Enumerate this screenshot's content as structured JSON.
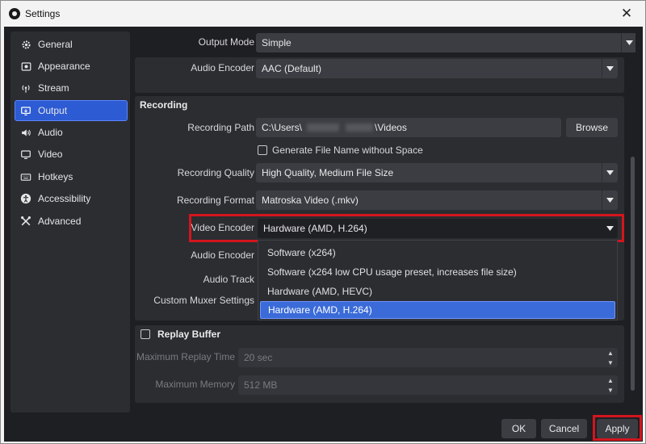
{
  "window": {
    "title": "Settings",
    "close_glyph": "✕"
  },
  "sidebar": {
    "items": [
      {
        "label": "General",
        "icon": "gear-icon"
      },
      {
        "label": "Appearance",
        "icon": "appearance-icon"
      },
      {
        "label": "Stream",
        "icon": "stream-icon"
      },
      {
        "label": "Output",
        "icon": "output-icon",
        "active": true
      },
      {
        "label": "Audio",
        "icon": "speaker-icon"
      },
      {
        "label": "Video",
        "icon": "monitor-icon"
      },
      {
        "label": "Hotkeys",
        "icon": "keyboard-icon"
      },
      {
        "label": "Accessibility",
        "icon": "accessibility-icon"
      },
      {
        "label": "Advanced",
        "icon": "tools-icon"
      }
    ]
  },
  "output": {
    "output_mode_label": "Output Mode",
    "output_mode_value": "Simple",
    "audio_encoder_label": "Audio Encoder",
    "audio_encoder_value": "AAC (Default)"
  },
  "recording": {
    "title": "Recording",
    "path_label": "Recording Path",
    "path_value_prefix": "C:\\Users\\",
    "path_value_suffix": "\\Videos",
    "browse_label": "Browse",
    "gen_filename_label": "Generate File Name without Space",
    "quality_label": "Recording Quality",
    "quality_value": "High Quality, Medium File Size",
    "format_label": "Recording Format",
    "format_value": "Matroska Video (.mkv)",
    "video_encoder_label": "Video Encoder",
    "video_encoder_value": "Hardware (AMD, H.264)",
    "audio_encoder_label": "Audio Encoder",
    "audio_track_label": "Audio Track",
    "custom_muxer_label": "Custom Muxer Settings",
    "encoder_options": [
      "Software (x264)",
      "Software (x264 low CPU usage preset, increases file size)",
      "Hardware (AMD, HEVC)",
      "Hardware (AMD, H.264)"
    ],
    "selected_option_index": 3
  },
  "replay": {
    "title": "Replay Buffer",
    "max_time_label": "Maximum Replay Time",
    "max_time_value": "20 sec",
    "max_memory_label": "Maximum Memory",
    "max_memory_value": "512 MB"
  },
  "footer": {
    "ok": "OK",
    "cancel": "Cancel",
    "apply": "Apply"
  },
  "colors": {
    "accent": "#2d5bd3",
    "highlight_red": "#d3151d",
    "panel": "#2b2d31",
    "background": "#1e1f23"
  }
}
